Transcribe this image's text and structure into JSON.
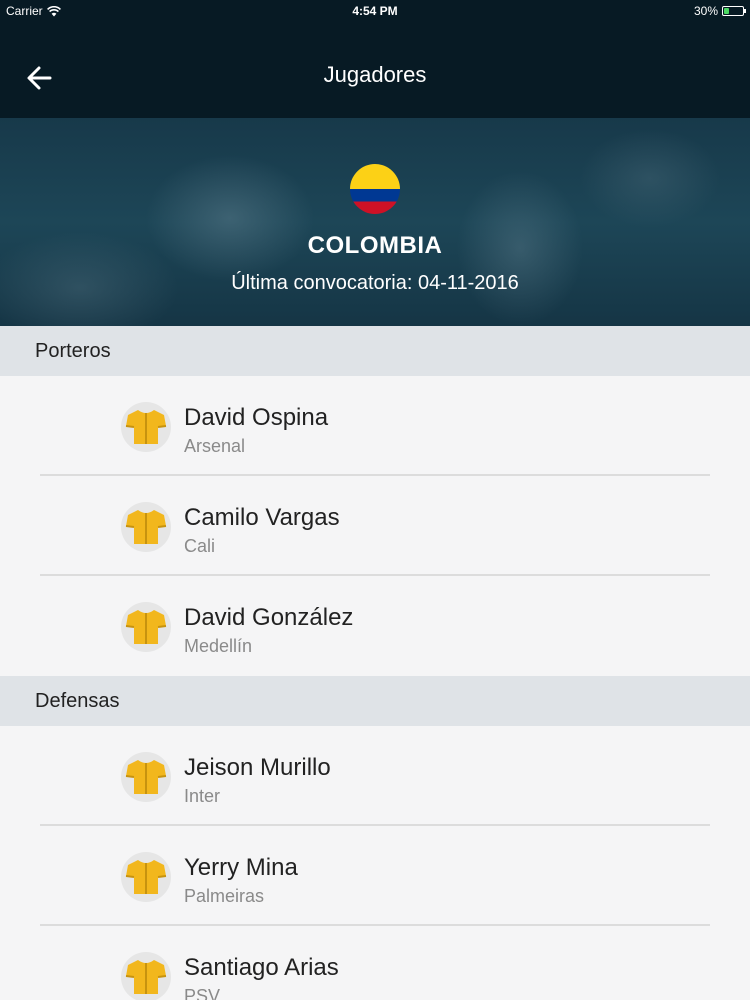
{
  "status_bar": {
    "carrier": "Carrier",
    "time": "4:54 PM",
    "battery": "30%",
    "battery_level": 0.3
  },
  "nav": {
    "title": "Jugadores"
  },
  "team": {
    "name": "COLOMBIA",
    "last_call": "Última convocatoria: 04-11-2016"
  },
  "sections": [
    {
      "title": "Porteros",
      "players": [
        {
          "name": "David Ospina",
          "club": "Arsenal"
        },
        {
          "name": "Camilo Vargas",
          "club": "Cali"
        },
        {
          "name": "David González",
          "club": "Medellín"
        }
      ]
    },
    {
      "title": "Defensas",
      "players": [
        {
          "name": "Jeison Murillo",
          "club": "Inter"
        },
        {
          "name": "Yerry Mina",
          "club": "Palmeiras"
        },
        {
          "name": "Santiago Arias",
          "club": "PSV"
        }
      ]
    }
  ],
  "colors": {
    "nav_bg": "#071a24",
    "jersey": "#f2b71d",
    "jersey_dark": "#c7930f"
  }
}
